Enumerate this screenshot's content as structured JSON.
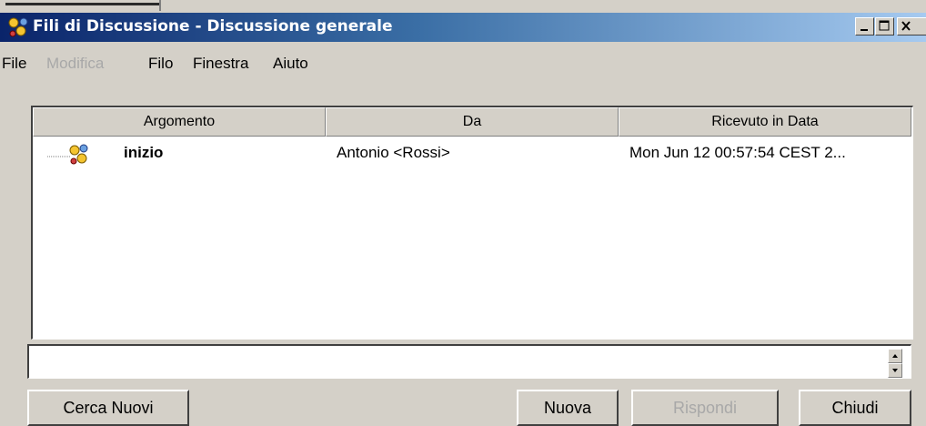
{
  "window": {
    "title": "Fili di Discussione - Discussione generale",
    "icon": "discussion-threads-icon",
    "controls": [
      "minimize-icon",
      "maximize-icon",
      "close-icon"
    ]
  },
  "menubar": {
    "items": [
      {
        "label": "File",
        "enabled": true
      },
      {
        "label": "Modifica",
        "enabled": false
      },
      {
        "label": "Filo",
        "enabled": true
      },
      {
        "label": "Finestra",
        "enabled": true
      },
      {
        "label": "Aiuto",
        "enabled": true
      }
    ]
  },
  "table": {
    "columns": [
      "Argomento",
      "Da",
      "Ricevuto in Data"
    ],
    "rows": [
      {
        "icon": "thread-node-icon",
        "topic": "inizio",
        "from": "Antonio <Rossi>",
        "received": "Mon Jun 12 00:57:54 CEST 2..."
      }
    ]
  },
  "message_field": {
    "value": ""
  },
  "buttons": {
    "search_new": "Cerca Nuovi",
    "new": "Nuova",
    "reply": "Rispondi",
    "reply_enabled": false,
    "close": "Chiudi"
  },
  "colors": {
    "titlebar_start": "#0a246a",
    "titlebar_end": "#a6caf0",
    "face": "#d4d0c8",
    "disabled_text": "#a8a8a8"
  }
}
